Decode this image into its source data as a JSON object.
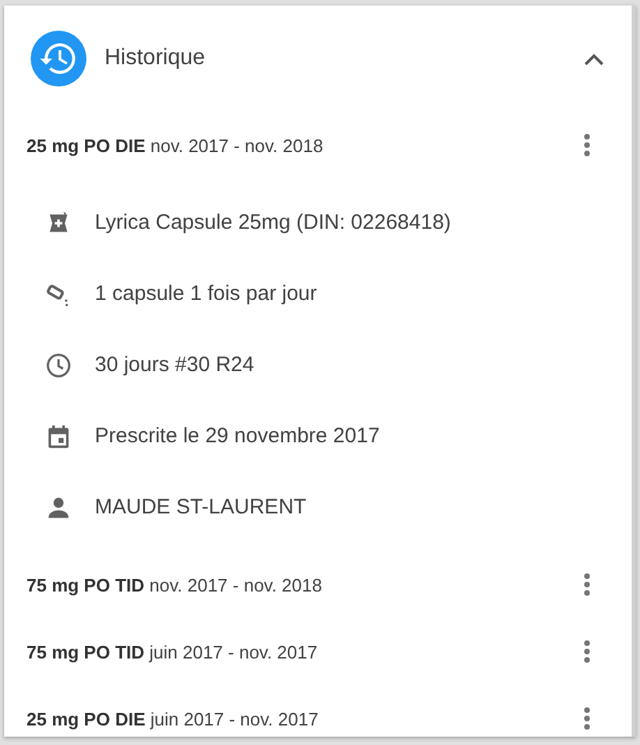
{
  "panel": {
    "title": "Historique",
    "expanded": true
  },
  "entries": [
    {
      "dose": "25 mg PO DIE",
      "period": "nov. 2017 - nov. 2018",
      "expanded": true,
      "details": [
        {
          "kind": "drug",
          "text": "Lyrica Capsule 25mg (DIN: 02268418)"
        },
        {
          "kind": "dose",
          "text": "1 capsule 1 fois par jour"
        },
        {
          "kind": "duration",
          "text": "30 jours #30 R24"
        },
        {
          "kind": "date",
          "text": "Prescrite le 29 novembre 2017"
        },
        {
          "kind": "person",
          "text": "MAUDE ST-LAURENT"
        }
      ]
    },
    {
      "dose": "75 mg PO TID",
      "period": "nov. 2017 - nov. 2018",
      "expanded": false
    },
    {
      "dose": "75 mg PO TID",
      "period": "juin 2017 - nov. 2017",
      "expanded": false
    },
    {
      "dose": "25 mg PO DIE",
      "period": "juin 2017 - nov. 2017",
      "expanded": false
    }
  ]
}
